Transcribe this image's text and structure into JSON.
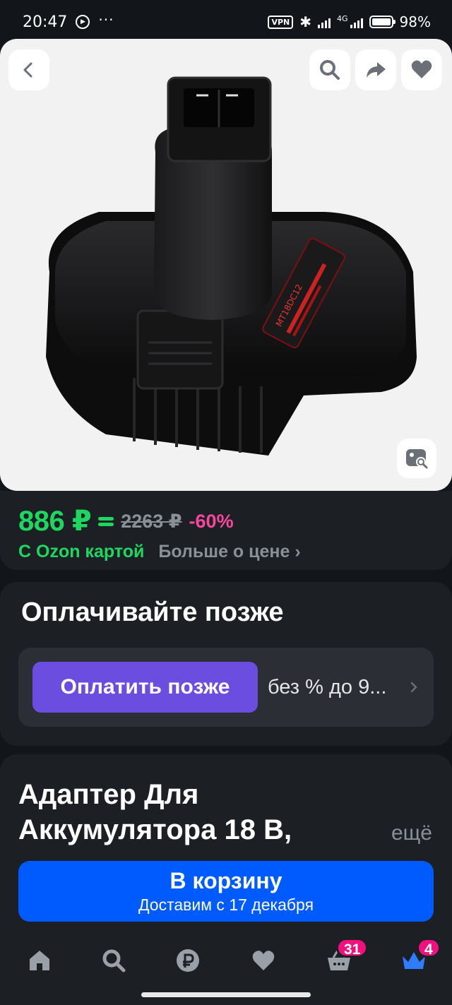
{
  "status_bar": {
    "time": "20:47",
    "network": "4G",
    "vpn": "VPN",
    "battery": "98%"
  },
  "hero": {
    "image_alt": "Адаптер для аккумулятора 18 В",
    "product_marking": "MT18DC12"
  },
  "price": {
    "current": "886 ₽",
    "old": "2263 ₽",
    "discount": "-60%",
    "ozon_card": "С Ozon картой",
    "more": "Больше о цене ›"
  },
  "pay_later": {
    "title": "Оплачивайте позже",
    "button": "Оплатить позже",
    "note": "без % до 9..."
  },
  "product": {
    "title": "Адаптер Для Аккумулятора 18 В,",
    "more": "ещё",
    "cart_button": "В корзину",
    "delivery": "Доставим с 17 декабря"
  },
  "nav": {
    "cart_badge": "31",
    "profile_badge": "4"
  },
  "colors": {
    "accent_green": "#1ed760",
    "discount_pink": "#f7479c",
    "pay_purple": "#6b4de0",
    "cart_blue": "#005bff",
    "badge_pink": "#f1117e",
    "nav_active_blue": "#2f7cff"
  }
}
